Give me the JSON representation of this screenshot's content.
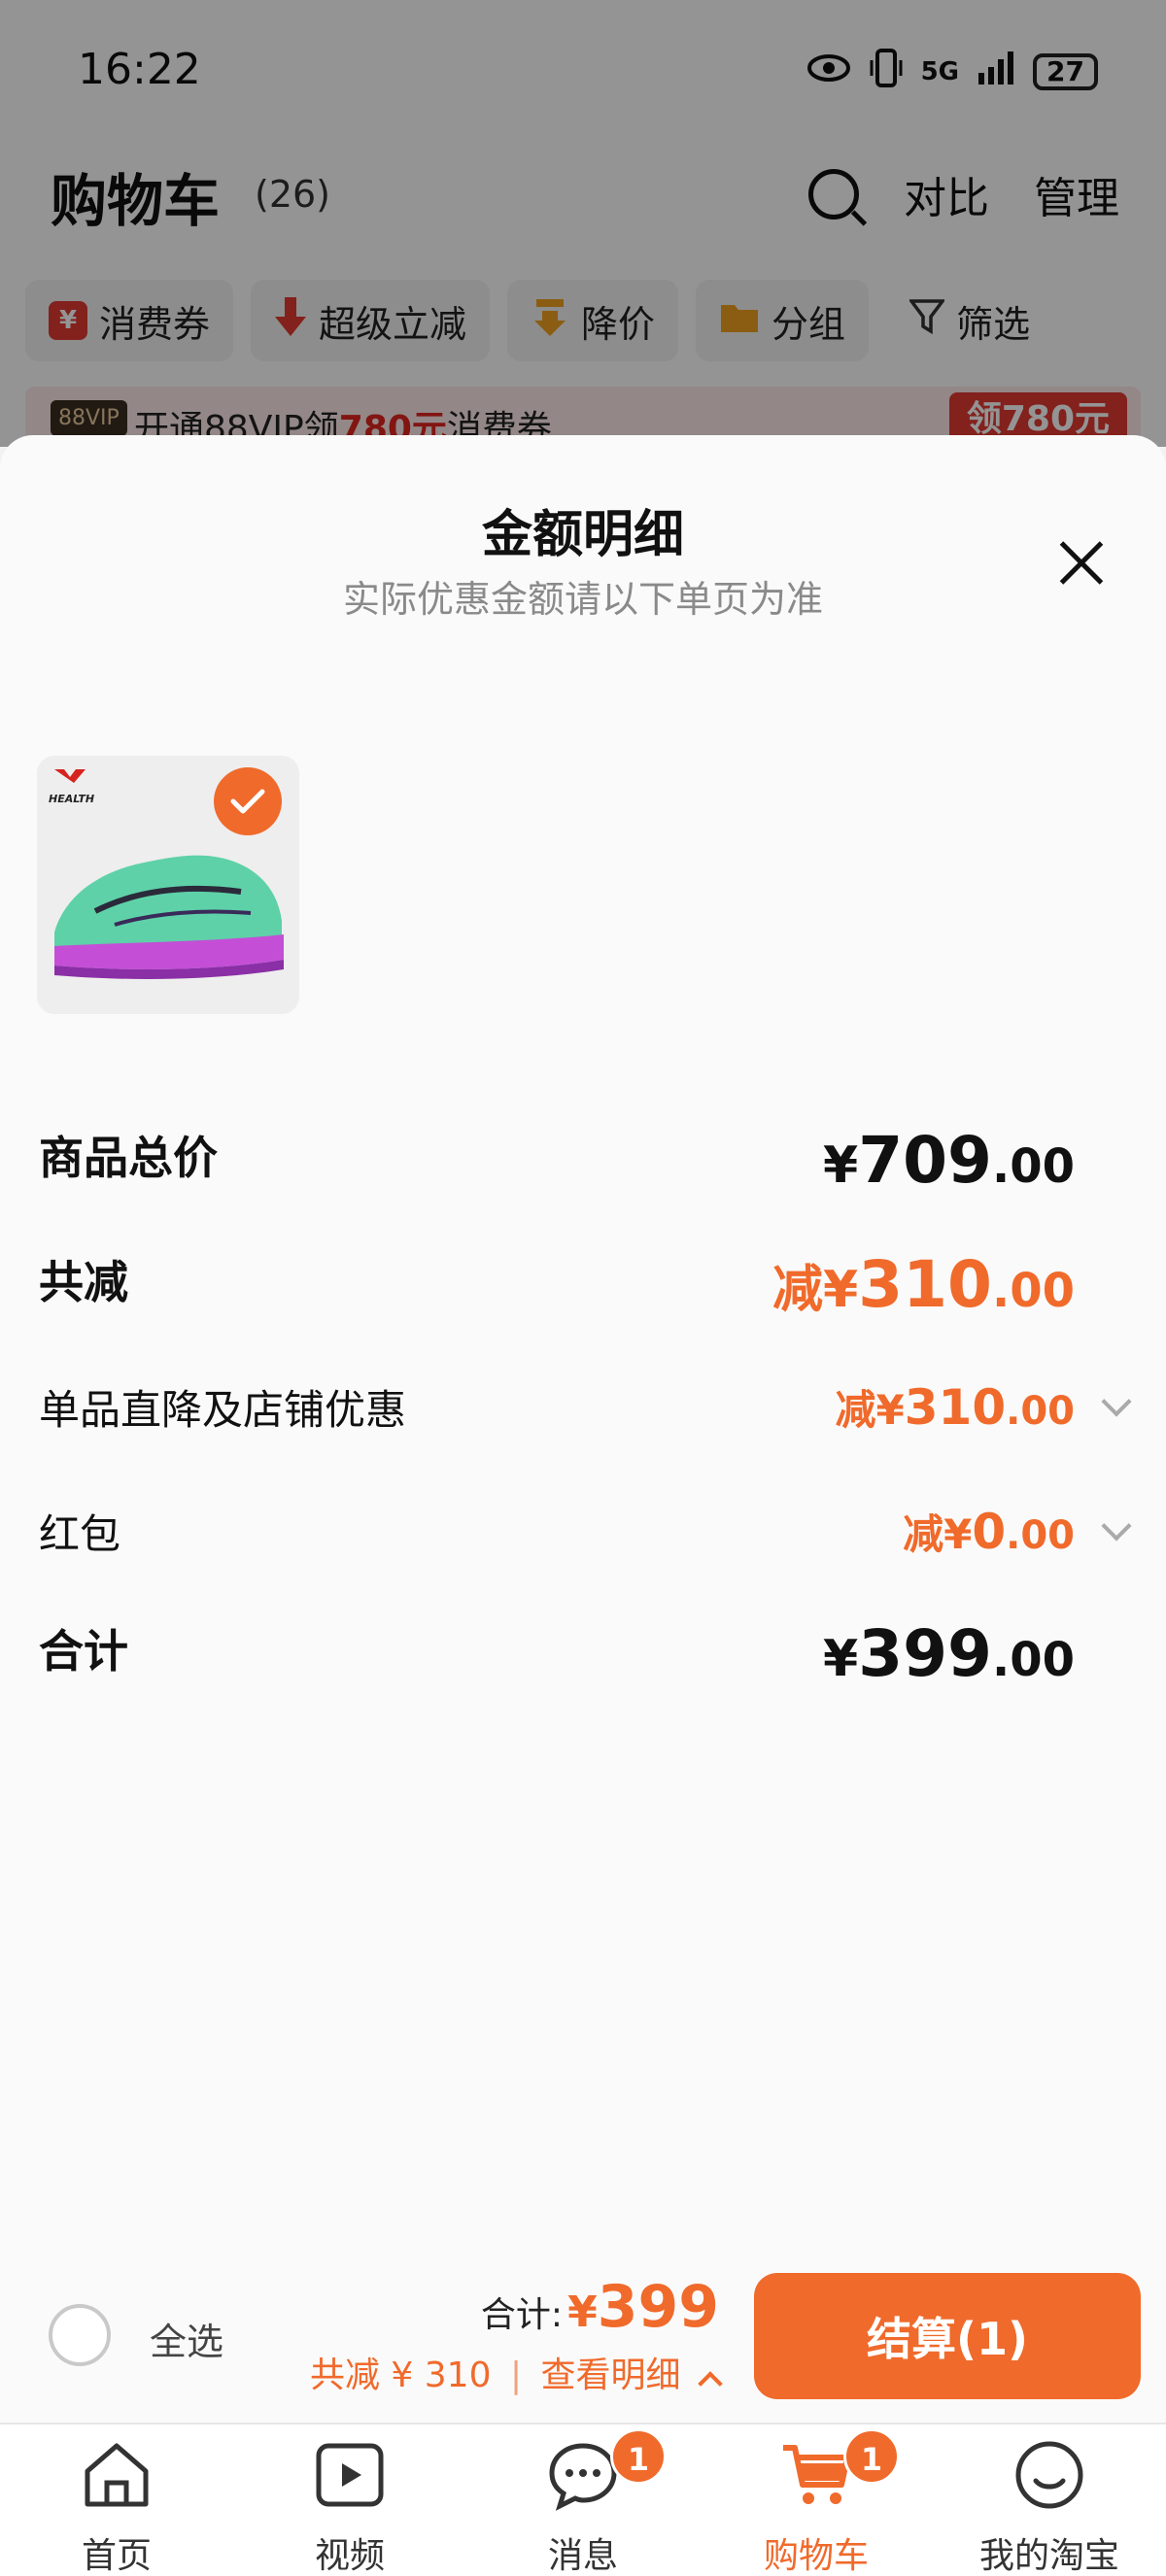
{
  "status_bar": {
    "time": "16:22",
    "signal": "5G",
    "battery": "27"
  },
  "cart": {
    "title": "购物车",
    "count": "(26)",
    "compare": "对比",
    "manage": "管理",
    "chips": [
      {
        "label": "消费券",
        "icon": "coupon-icon",
        "color": "#e23a33"
      },
      {
        "label": "超级立减",
        "icon": "arrow-down-icon",
        "color": "#e23a33"
      },
      {
        "label": "降价",
        "icon": "price-drop-icon",
        "color": "#f0a020"
      },
      {
        "label": "分组",
        "icon": "folder-icon",
        "color": "#f0a020"
      },
      {
        "label": "筛选",
        "icon": "filter-icon"
      }
    ],
    "vip": {
      "badge": "88VIP",
      "prefix": "开通88VIP领",
      "amount": "780元",
      "suffix": "消费券",
      "button": "领780元"
    }
  },
  "sheet": {
    "title": "金额明细",
    "subtitle": "实际优惠金额请以下单页为准",
    "product": {
      "brand": "HEALTH"
    },
    "rows": {
      "total_price": {
        "label": "商品总价",
        "cur": "¥",
        "int": "709",
        "dec": ".00"
      },
      "discount": {
        "label": "共减",
        "prefix": "减¥",
        "int": "310",
        "dec": ".00"
      },
      "store": {
        "label": "单品直降及店铺优惠",
        "prefix": "减¥",
        "int": "310",
        "dec": ".00"
      },
      "redpacket": {
        "label": "红包",
        "prefix": "减¥",
        "int": "0",
        "dec": ".00"
      },
      "sum": {
        "label": "合计",
        "cur": "¥",
        "int": "399",
        "dec": ".00"
      }
    }
  },
  "checkout": {
    "select_all": "全选",
    "total_label": "合计:",
    "total_cur": "¥",
    "total_amount": "399",
    "saved": "共减 ¥ 310",
    "sep": "|",
    "details": "查看明细",
    "button": "结算(1)"
  },
  "tabs": [
    {
      "label": "首页",
      "icon": "home-icon"
    },
    {
      "label": "视频",
      "icon": "video-icon"
    },
    {
      "label": "消息",
      "icon": "message-icon",
      "badge": "1"
    },
    {
      "label": "购物车",
      "icon": "cart-icon",
      "badge": "1",
      "active": true
    },
    {
      "label": "我的淘宝",
      "icon": "profile-icon"
    }
  ]
}
